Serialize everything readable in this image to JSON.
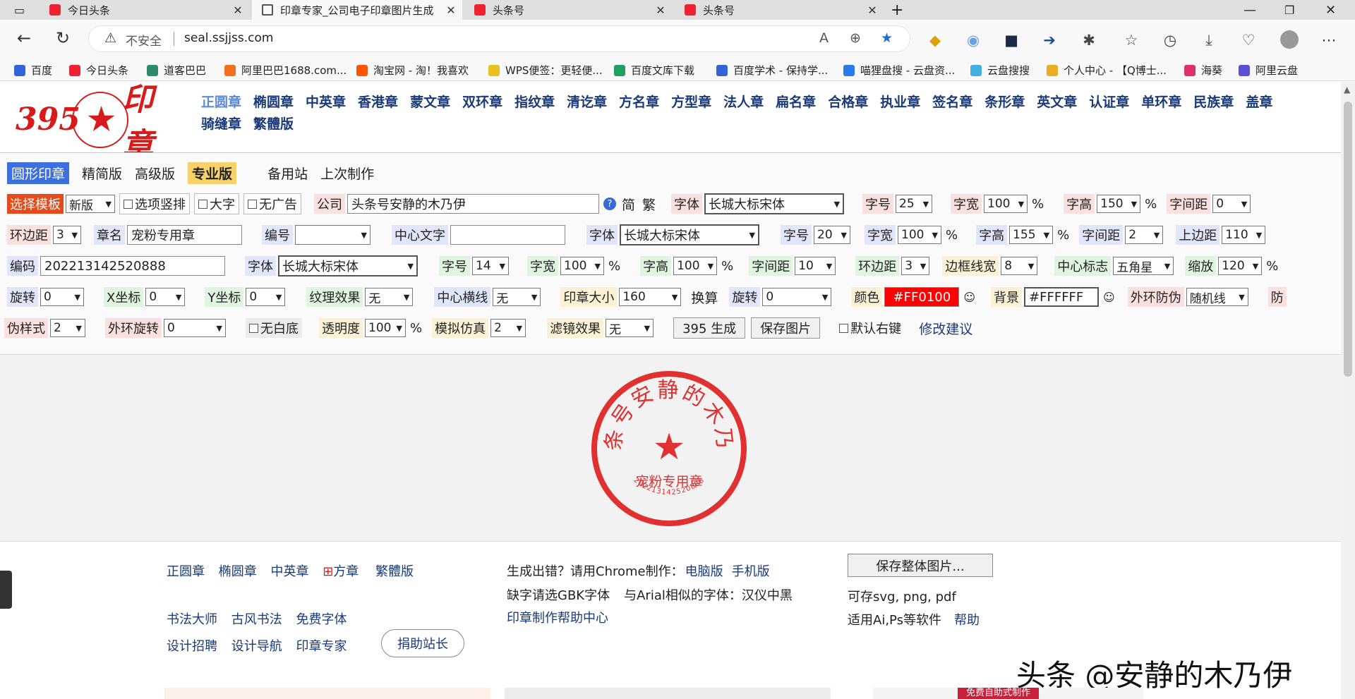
{
  "tabs": [
    {
      "title": "今日头条",
      "active": false
    },
    {
      "title": "印章专家_公司电子印章图片生成",
      "active": true
    },
    {
      "title": "头条号",
      "active": false
    },
    {
      "title": "头条号",
      "active": false
    }
  ],
  "addr": {
    "security": "不安全",
    "url": "seal.ssjjss.com"
  },
  "bookmarks": [
    "百度",
    "今日头条",
    "道客巴巴",
    "阿里巴巴1688.com...",
    "淘宝网 - 淘！我喜欢",
    "WPS便签：更轻便...",
    "百度文库下载",
    "百度学术 - 保持学...",
    "喵狸盘搜 - 云盘资...",
    "云盘搜搜",
    "个人中心 - 【Q博士...",
    "海葵",
    "阿里云盘"
  ],
  "logo": {
    "num": "395",
    "star": "★",
    "txt": "印章"
  },
  "topnav": [
    "正圆章",
    "椭圆章",
    "中英章",
    "香港章",
    "蒙文章",
    "双环章",
    "指纹章",
    "清讫章",
    "方名章",
    "方型章",
    "法人章",
    "扁名章",
    "合格章",
    "执业章",
    "签名章",
    "条形章",
    "英文章",
    "认证章",
    "单环章",
    "民族章",
    "盖章",
    "骑缝章",
    "繁體版"
  ],
  "modes": [
    "圆形印章",
    "精简版",
    "高级版",
    "专业版",
    "备用站",
    "上次制作"
  ],
  "form": {
    "template": "选择模板",
    "ver": "新版",
    "opt_vertical": "选项竖排",
    "opt_big": "大字",
    "opt_noad": "无广告",
    "company_label": "公司",
    "company": "头条号安静的木乃伊",
    "simp": "简",
    "trad": "繁",
    "font": "字体",
    "font_val": "长城大标宋体",
    "size": "字号",
    "width": "字宽",
    "height": "字高",
    "spacing": "字间距",
    "pct": "%",
    "r1_size": "25",
    "r1_w": "100",
    "r1_h": "150",
    "r1_sp": "0",
    "ring_margin": "环边距",
    "r2_margin": "3",
    "seal_name_label": "章名",
    "seal_name": "宠粉专用章",
    "number_label": "编号",
    "center_text_label": "中心文字",
    "r2_size": "20",
    "r2_w": "100",
    "r2_h": "155",
    "r2_sp": "2",
    "top_margin_label": "上边距",
    "r2_top": "110",
    "code_label": "编码",
    "code": "202213142520888",
    "r3_size": "14",
    "r3_w": "100",
    "r3_h": "100",
    "r3_sp": "10",
    "r3_margin": "3",
    "border_label": "边框线宽",
    "border": "8",
    "center_logo_label": "中心标志",
    "center_logo": "五角星",
    "scale_label": "缩放",
    "scale": "120",
    "rotate_label": "旋转",
    "rotate": "0",
    "x_label": "X坐标",
    "x": "0",
    "y_label": "Y坐标",
    "y": "0",
    "texture_label": "纹理效果",
    "texture": "无",
    "hline_label": "中心横线",
    "hline": "无",
    "seal_size_label": "印章大小",
    "seal_size": "160",
    "calc": "换算",
    "rotate2": "0",
    "color_label": "颜色",
    "color": "#FF0100",
    "bg_label": "背景",
    "bg": "#FFFFFF",
    "outer_label": "外环防伪",
    "outer": "随机线",
    "anti": "防",
    "pstyle_label": "伪样式",
    "pstyle": "2",
    "outer_rot_label": "外环旋转",
    "outer_rot": "0",
    "nowhite": "无白底",
    "opacity_label": "透明度",
    "opacity": "100",
    "sim_label": "模拟仿真",
    "sim": "2",
    "filter_label": "滤镜效果",
    "filter": "无",
    "gen": "395 生成",
    "save": "保存图片",
    "rightkey": "默认右键",
    "suggest": "修改建议"
  },
  "seal": {
    "top": "头条号安静的木乃伊",
    "name": "宠粉专用章",
    "code": "202213142520888",
    "star": "★",
    "color": "#e03030"
  },
  "footer": {
    "links1": [
      "正圆章",
      "椭圆章",
      "中英章",
      "方章",
      "繁體版"
    ],
    "links2": [
      "书法大师",
      "古风书法",
      "免费字体"
    ],
    "donate": "捐助站长",
    "links3": [
      "设计招聘",
      "设计导航",
      "印章专家"
    ],
    "err1": "生成出错？请用Chrome制作：",
    "pc": "电脑版",
    "mobile": "手机版",
    "err2": "缺字请选GBK字体",
    "err3": "与Arial相似的字体：汉仪中黑",
    "help_center": "印章制作帮助中心",
    "save_all": "保存整体图片...",
    "formats": "可存svg, png, pdf",
    "apps": "适用Ai,Ps等软件",
    "help": "帮助"
  },
  "watermark": "头条 @安静的木乃伊",
  "banner_text": "免费自助式制作"
}
